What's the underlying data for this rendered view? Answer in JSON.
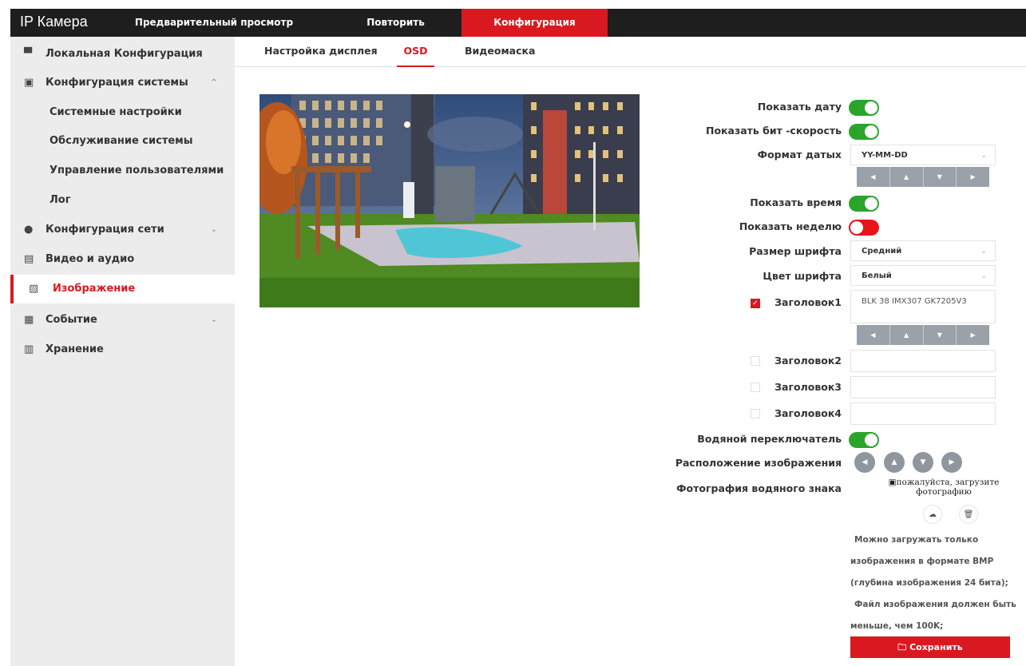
{
  "header": {
    "brand": "IP Камера",
    "nav": [
      "Предварительный просмотр",
      "Повторить",
      "Конфигурация"
    ]
  },
  "sidebar": {
    "items": [
      {
        "label": "Локальная Конфигурация",
        "icon": "monitor-icon"
      },
      {
        "label": "Конфигурация системы",
        "icon": "system-icon",
        "chevron": "up"
      },
      {
        "label": "Системные настройки"
      },
      {
        "label": "Обслуживание системы"
      },
      {
        "label": "Управление пользователями"
      },
      {
        "label": "Лог"
      },
      {
        "label": "Конфигурация сети",
        "icon": "globe-icon",
        "chevron": "down"
      },
      {
        "label": "Видео и аудио",
        "icon": "video-icon"
      },
      {
        "label": "Изображение",
        "icon": "image-icon",
        "active": true
      },
      {
        "label": "Событие",
        "icon": "event-icon",
        "chevron": "down"
      },
      {
        "label": "Хранение",
        "icon": "storage-icon"
      }
    ]
  },
  "tabs": [
    "Настройка дисплея",
    "OSD",
    "Видеомаска"
  ],
  "osd": {
    "show_date_label": "Показать дату",
    "show_date": true,
    "show_bitrate_label": "Показать бит -скорость",
    "show_bitrate": true,
    "date_format_label": "Формат датых",
    "date_format_value": "YY-MM-DD",
    "show_time_label": "Показать время",
    "show_time": true,
    "show_week_label": "Показать неделю",
    "show_week": false,
    "font_size_label": "Размер шрифта",
    "font_size_value": "Средний",
    "font_color_label": "Цвет шрифта",
    "font_color_value": "Белый",
    "title1_label": "Заголовок1",
    "title1_value": "BLK 38 IMX307 GK7205V3",
    "title2_label": "Заголовок2",
    "title3_label": "Заголовок3",
    "title4_label": "Заголовок4",
    "watermark_switch_label": "Водяной переключатель",
    "watermark_switch": true,
    "image_position_label": "Расположение изображения",
    "watermark_photo_label": "Фотография водяного знака",
    "upload_placeholder": "пожалуйста, загрузите фотографию",
    "note_lines": [
      "Можно загружать только",
      "изображения в формате BMP",
      "(глубина изображения 24 бита);",
      "Файл изображения должен быть",
      "меньше, чем 100K;"
    ],
    "save_label": "Сохранить"
  },
  "colors": {
    "accent": "#d9191f",
    "toggle_on": "#2aa52a",
    "toggle_off": "#e8141a",
    "topbar": "#1e1e1e",
    "sidebar": "#ececec"
  }
}
